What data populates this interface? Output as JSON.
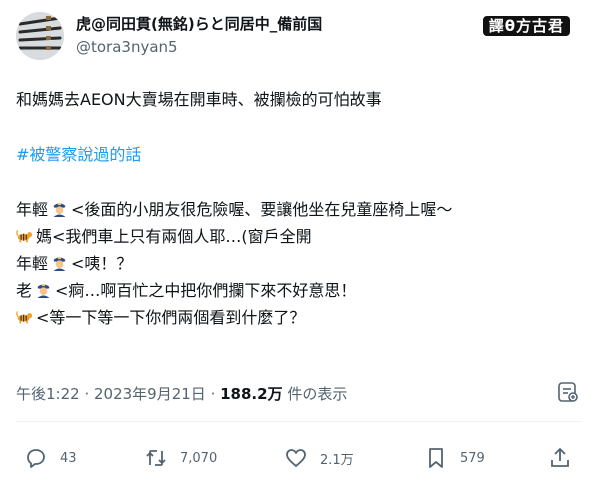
{
  "author": {
    "display_name": "虎@同田貫(無銘)らと同居中_備前国",
    "handle": "@tora3nyan5",
    "avatar_icon": "avatar-swords-image"
  },
  "watermark": "譯θ方古君",
  "tweet": {
    "line1": "和媽媽去AEON大賣場在開車時、被攔檢的可怕故事",
    "hashtag": "#被警察說過的話",
    "dialogue": [
      {
        "speaker": "年輕",
        "icon": "police-officer-icon",
        "text": "<後面的小朋友很危險喔、要讓他坐在兒童座椅上喔～"
      },
      {
        "speaker": "",
        "icon": "tiger-icon",
        "text": "媽<我們車上只有兩個人耶…(窗戶全開"
      },
      {
        "speaker": "年輕",
        "icon": "police-officer-icon",
        "text": "<咦！？"
      },
      {
        "speaker": "老",
        "icon": "police-officer-icon",
        "text": "<痾…啊百忙之中把你們攔下來不好意思！"
      },
      {
        "speaker": "",
        "icon": "tiger-icon",
        "text": "<等一下等一下你們兩個看到什麼了？"
      }
    ]
  },
  "meta": {
    "time": "午後1:22",
    "sep": " · ",
    "date": "2023年9月21日",
    "views_count": "188.2万",
    "views_label": " 件の表示"
  },
  "actions": {
    "replies": "43",
    "retweets": "7,070",
    "likes": "2.1万",
    "bookmarks": "579"
  },
  "colors": {
    "text": "#0f1419",
    "secondary": "#536471",
    "hashtag": "#1d9bf0",
    "divider": "#eff3f4"
  }
}
